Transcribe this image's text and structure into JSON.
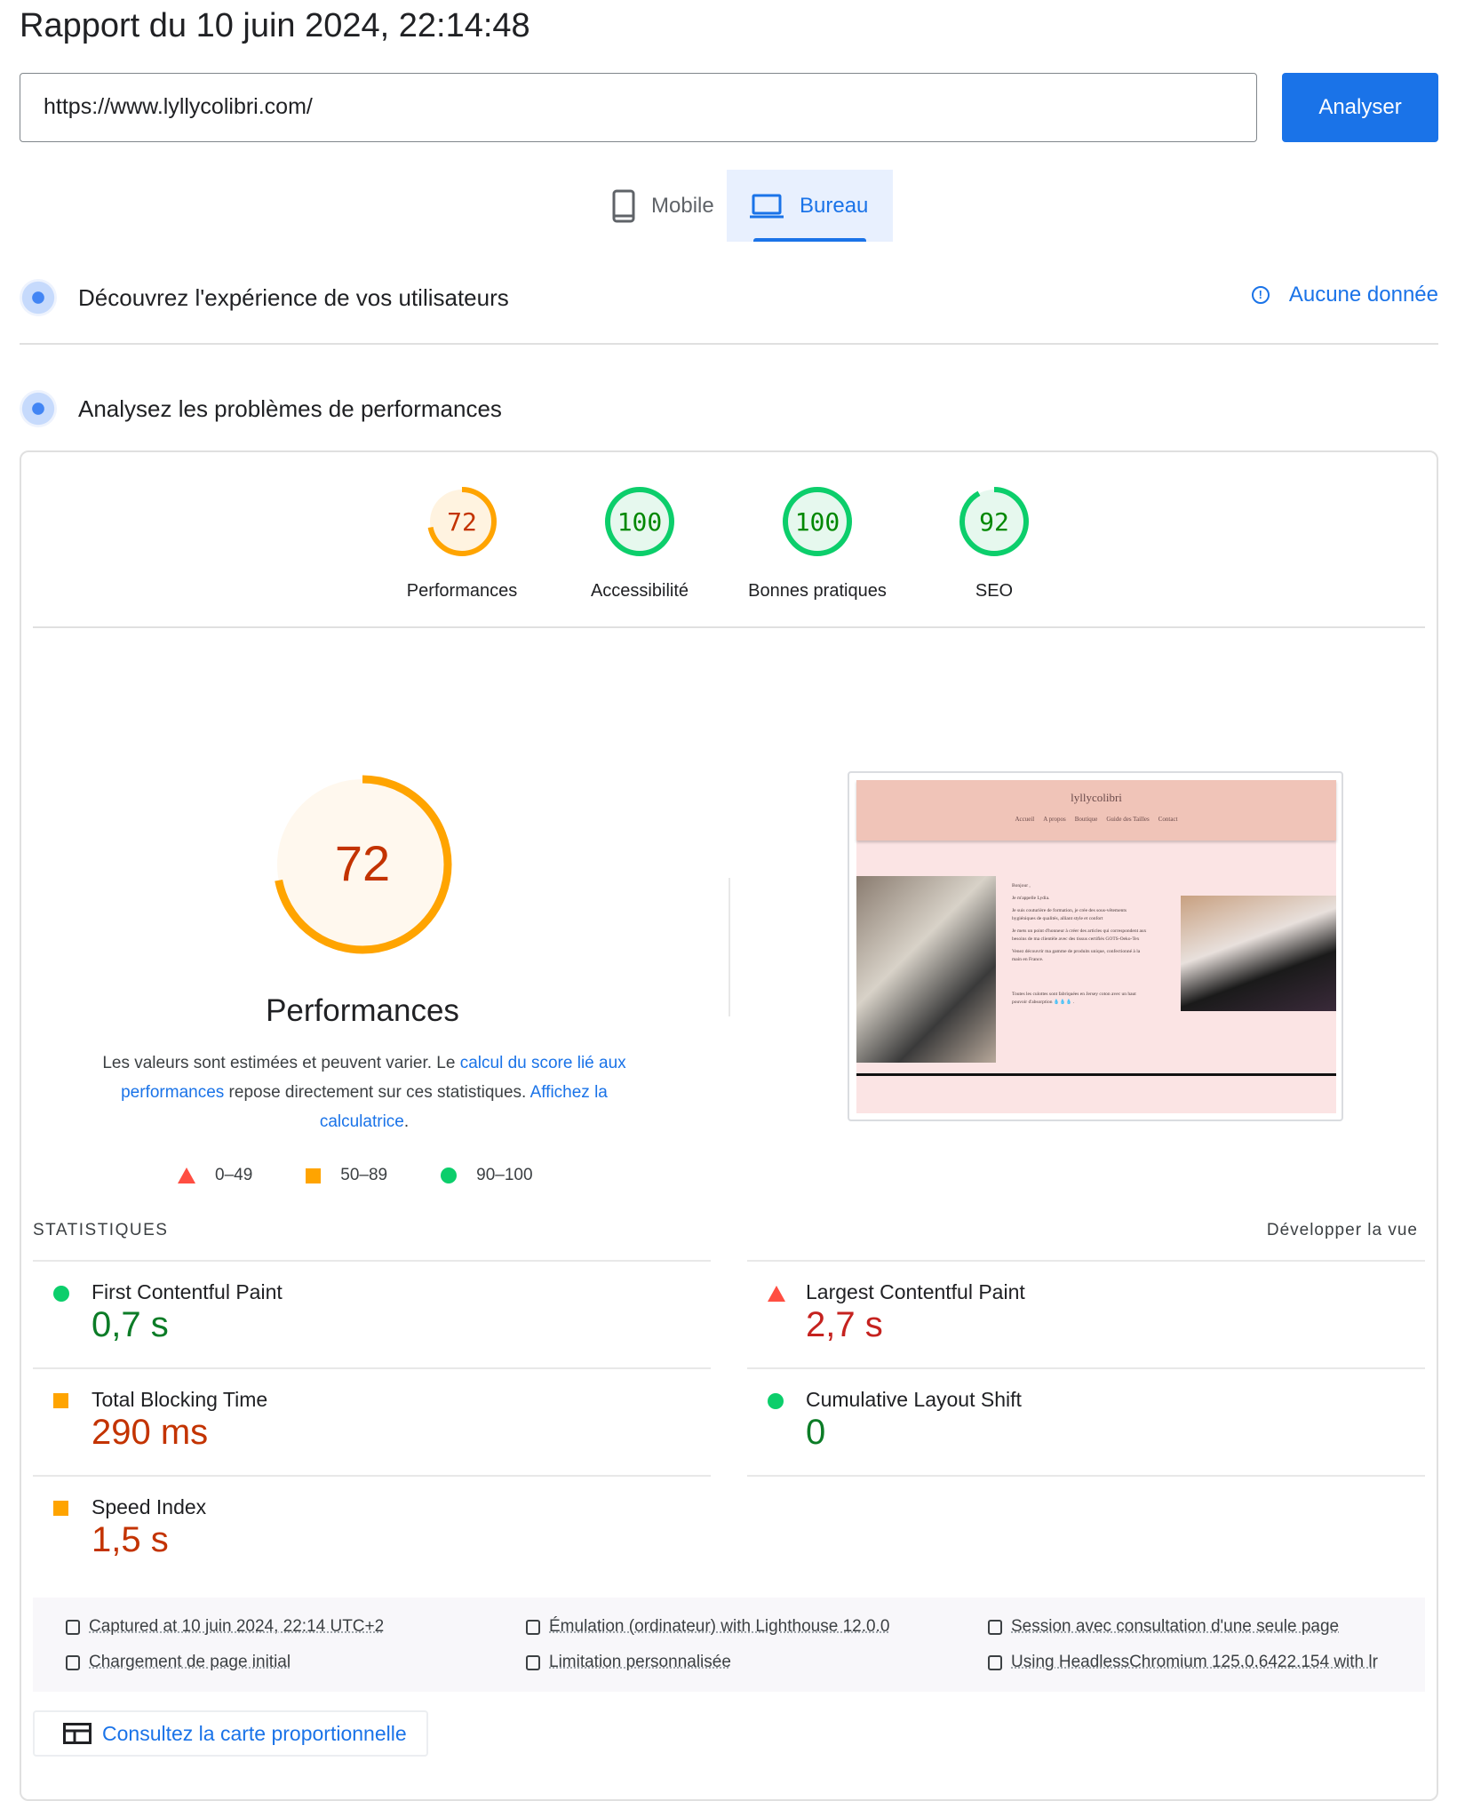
{
  "header": {
    "title": "Rapport du 10 juin 2024, 22:14:48",
    "url_value": "https://www.lyllycolibri.com/",
    "analyze_label": "Analyser"
  },
  "tabs": [
    {
      "label": "Mobile",
      "icon": "phone-icon",
      "active": false
    },
    {
      "label": "Bureau",
      "icon": "laptop-icon",
      "active": true
    }
  ],
  "sections": {
    "field": {
      "title": "Découvrez l'expérience de vos utilisateurs",
      "no_data": "Aucune donnée"
    },
    "lab": {
      "title": "Analysez les problèmes de performances"
    }
  },
  "scores": [
    {
      "label": "Performances",
      "value": 72,
      "color": "#ffa400"
    },
    {
      "label": "Accessibilité",
      "value": 100,
      "color": "#0cce6b"
    },
    {
      "label": "Bonnes pratiques",
      "value": 100,
      "color": "#0cce6b"
    },
    {
      "label": "SEO",
      "value": 92,
      "color": "#0cce6b"
    }
  ],
  "main_gauge": {
    "value": 72,
    "title": "Performances"
  },
  "description": {
    "p1": "Les valeurs sont estimées et peuvent varier. Le ",
    "link1": "calcul du score lié aux performances",
    "p2": " repose directement sur ces statistiques. ",
    "link2": "Affichez la calculatrice",
    "p3": "."
  },
  "legend": [
    {
      "range": "0–49",
      "shape": "triangle",
      "color": "#ff4e42"
    },
    {
      "range": "50–89",
      "shape": "square",
      "color": "#ffa400"
    },
    {
      "range": "90–100",
      "shape": "circle",
      "color": "#0cce6b"
    }
  ],
  "stats": {
    "heading": "STATISTIQUES",
    "expand": "Développer la vue",
    "metrics": [
      {
        "name": "First Contentful Paint",
        "value": "0,7 s",
        "rating": "good",
        "color": "#0c7c27"
      },
      {
        "name": "Largest Contentful Paint",
        "value": "2,7 s",
        "rating": "poor",
        "color": "#c5221f"
      },
      {
        "name": "Total Blocking Time",
        "value": "290 ms",
        "rating": "average",
        "color": "#c33300"
      },
      {
        "name": "Cumulative Layout Shift",
        "value": "0",
        "rating": "good",
        "color": "#0c7c27"
      },
      {
        "name": "Speed Index",
        "value": "1,5 s",
        "rating": "average",
        "color": "#c33300"
      }
    ]
  },
  "thumbnail": {
    "site_name": "lyllycolibri",
    "nav": [
      "Accueil",
      "A propos",
      "Boutique",
      "Guide des Tailles",
      "Contact"
    ],
    "paragraphs": [
      "Bonjour ,",
      "Je m'appelle Lydia.",
      "Je suis couturière de formation, je crée des sous-vêtements hygiéniques de qualités, alliant style et confort",
      "Je mets un point d'honneur à créer des articles qui correspondent aux besoins de ma clientèle avec des tissus certifiés GOTS-Oeko-Tex",
      "Venez découvrir ma gamme de produits unique, confectionné à la main en France.",
      "Toutes les culottes sont fabriquées en Jersey coton avec un haut pouvoir d'absorption 💧💧💧 ."
    ]
  },
  "footer": {
    "items": [
      {
        "icon": "calendar-icon",
        "text": "Captured at 10 juin 2024, 22:14 UTC+2"
      },
      {
        "icon": "devices-icon",
        "text": "Émulation (ordinateur) with Lighthouse 12.0.0"
      },
      {
        "icon": "users-icon",
        "text": "Session avec consultation d'une seule page"
      },
      {
        "icon": "timer-icon",
        "text": "Chargement de page initial"
      },
      {
        "icon": "network-icon",
        "text": "Limitation personnalisée"
      },
      {
        "icon": "chrome-icon",
        "text": "Using HeadlessChromium 125.0.6422.154 with lr"
      }
    ],
    "treemap_label": "Consultez la carte proportionnelle"
  }
}
